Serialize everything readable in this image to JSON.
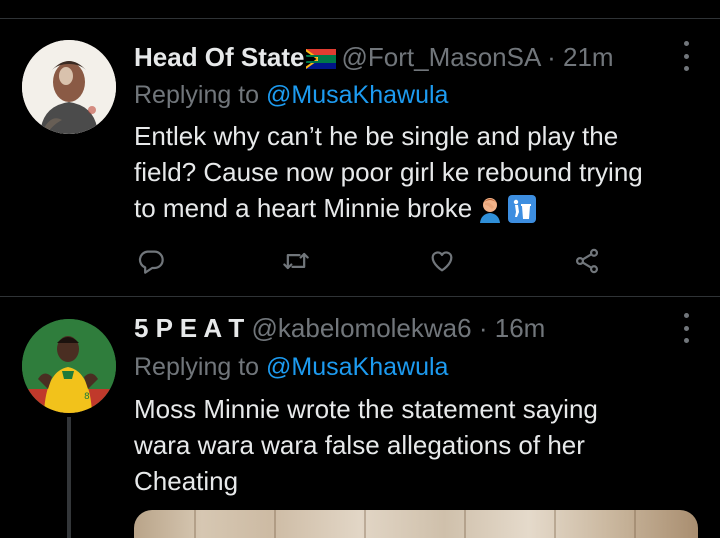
{
  "tweets": [
    {
      "display_name": "Head Of State",
      "handle": "@Fort_MasonSA",
      "separator": "·",
      "time": "21m",
      "reply_prefix": "Replying to",
      "reply_to": "@MusaKhawula",
      "text_lines": [
        "Entlek why can’t he be single and play the",
        "field? Cause now poor girl ke rebound trying",
        "to mend a heart Minnie broke"
      ],
      "emojis": [
        "person-facepalming-icon",
        "litter-in-bin-icon"
      ],
      "actions": [
        "reply-icon",
        "retweet-icon",
        "like-icon",
        "share-icon"
      ]
    },
    {
      "display_name": "5 P E A T",
      "handle": "@kabelomolekwa6",
      "separator": "·",
      "time": "16m",
      "reply_prefix": "Replying to",
      "reply_to": "@MusaKhawula",
      "text_lines": [
        "Moss Minnie wrote the statement saying",
        "wara wara wara false allegations of her",
        "Cheating"
      ]
    }
  ],
  "colors": {
    "background": "#000000",
    "text": "#e7e9ea",
    "secondary": "#71767b",
    "link": "#1d9bf0",
    "divider": "#2f3336"
  }
}
